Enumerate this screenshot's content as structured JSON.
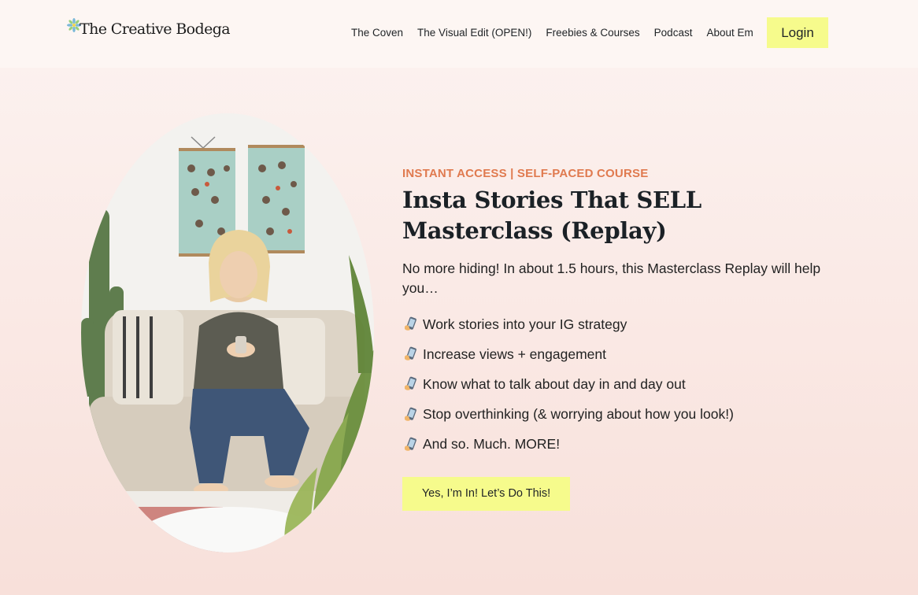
{
  "header": {
    "logo_text": "The Creative Bodega",
    "nav": [
      {
        "label": "The Coven"
      },
      {
        "label": "The Visual Edit (OPEN!)"
      },
      {
        "label": "Freebies & Courses"
      },
      {
        "label": "Podcast"
      },
      {
        "label": "About Em"
      }
    ],
    "login_label": "Login"
  },
  "hero": {
    "eyebrow": "INSTANT ACCESS | SELF-PACED COURSE",
    "title": "Insta Stories That SELL Masterclass (Replay)",
    "intro": "No more hiding! In about 1.5 hours, this Masterclass Replay will help you…",
    "bullets": [
      {
        "text": "Work stories into your IG strategy"
      },
      {
        "text": "Increase views + engagement"
      },
      {
        "text": "Know what to talk about day in and day out"
      },
      {
        "text": "Stop overthinking (& worrying about how you look!)"
      },
      {
        "text": "And so. Much. MORE!"
      }
    ],
    "cta_label": "Yes, I’m In! Let’s Do This!",
    "bullet_icon": "phone-icon",
    "photo": "woman-on-couch-with-phone-photo"
  },
  "colors": {
    "accent_yellow": "#f6fb8c",
    "eyebrow_orange": "#e07a4f",
    "header_bg": "#fdf6f3"
  }
}
